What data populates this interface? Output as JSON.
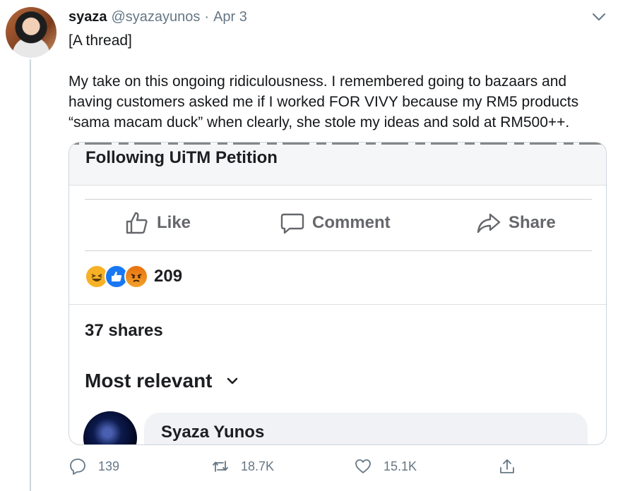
{
  "tweet": {
    "display_name": "syaza",
    "handle": "@syazayunos",
    "separator": "·",
    "date": "Apr 3",
    "text": "[A thread]\n\nMy take on this ongoing ridiculousness. I remembered going to bazaars and having customers asked me if I worked FOR VIVY because my RM5 products “sama macam duck” when clearly, she stole my ideas and sold at RM500++."
  },
  "facebook_card": {
    "post_title": "Following UiTM Petition",
    "actions": {
      "like": "Like",
      "comment": "Comment",
      "share": "Share"
    },
    "reaction_icons": [
      "haha-icon",
      "like-icon",
      "angry-icon"
    ],
    "reaction_count": "209",
    "shares": "37 shares",
    "sort_label": "Most relevant",
    "commenter_name": "Syaza Yunos"
  },
  "tweet_actions": {
    "replies": "139",
    "retweets": "18.7K",
    "likes": "15.1K"
  },
  "colors": {
    "twitter_gray": "#657786",
    "facebook_gray": "#65676b",
    "facebook_blue": "#1877f2",
    "divider": "#ccd6dd"
  }
}
